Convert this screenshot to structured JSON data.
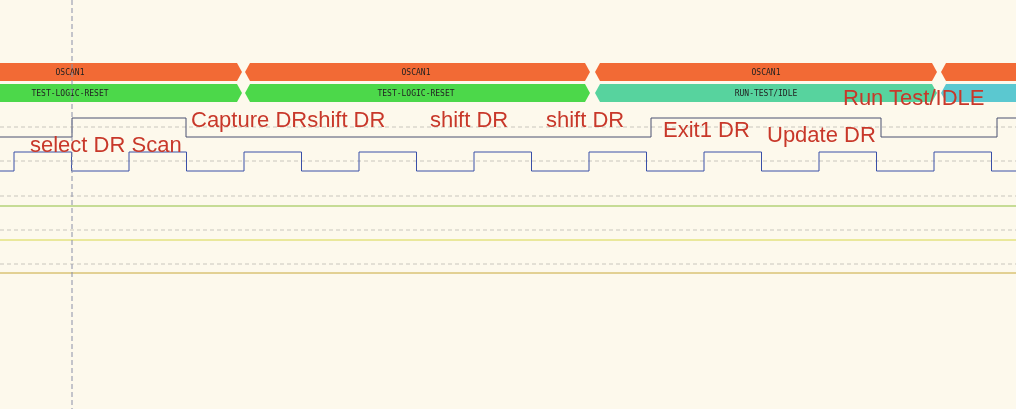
{
  "decoder_rows": [
    {
      "segments": [
        {
          "label": "OSCAN1",
          "color": "#f26a35"
        },
        {
          "label": "OSCAN1",
          "color": "#f26a35"
        },
        {
          "label": "OSCAN1",
          "color": "#f26a35"
        },
        {
          "color": "#f26a35"
        }
      ]
    },
    {
      "segments": [
        {
          "label": "TEST-LOGIC-RESET",
          "color": "#4cd84a"
        },
        {
          "label": "TEST-LOGIC-RESET",
          "color": "#4cd84a"
        },
        {
          "label": "RUN-TEST/IDLE",
          "color": "#57d39e"
        },
        {
          "color": "#5bc8d0"
        }
      ]
    }
  ],
  "annotations": [
    {
      "text": "select DR Scan"
    },
    {
      "text": "Capture DRshift DR"
    },
    {
      "text": "shift DR"
    },
    {
      "text": "shift DR"
    },
    {
      "text": "Exit1 DR"
    },
    {
      "text": "Update DR"
    },
    {
      "text": "Run Test/IDLE"
    }
  ]
}
